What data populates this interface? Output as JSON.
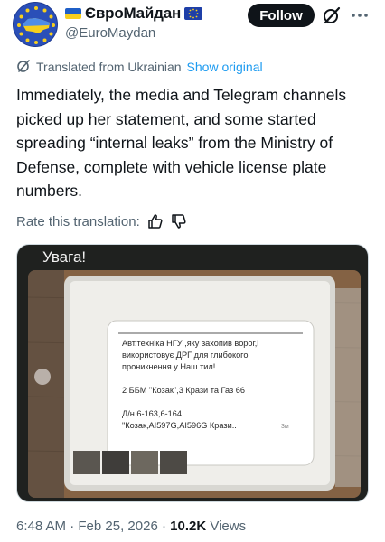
{
  "account": {
    "display_name": "ЄвроМайдан",
    "handle": "@EuroMaydan",
    "follow_label": "Follow"
  },
  "translation": {
    "label": "Translated from Ukrainian",
    "show_original": "Show original"
  },
  "tweet": {
    "text": "Immediately, the media and Telegram channels picked up her statement, and some started spreading “internal leaks” from the Ministry of Defense, complete with vehicle license plate numbers."
  },
  "rate": {
    "label": "Rate this translation:"
  },
  "media": {
    "title": "Увага!",
    "doc_lines": [
      "Авт.техніка НГУ ,яку захопив ворог,і",
      "використовує ДРГ для глибокого",
      "проникнення у Наш тил!",
      "2 ББМ \"Козак\",3 Крази та Газ 66",
      "Д/н 6-163,6-164",
      "\"Козак,АІ597G,АІ596G Крази..",
      "3м"
    ]
  },
  "meta": {
    "time": "6:48 AM",
    "date": "Feb 25, 2026",
    "separator": "·",
    "views_count": "10.2K",
    "views_label": "Views"
  },
  "colors": {
    "text": "#0f1419",
    "secondary": "#536471",
    "link": "#1d9bf0",
    "avatar_blue": "#2a4fb8",
    "ua_blue": "#1f5fc7",
    "ua_yellow": "#f6cf1e"
  },
  "icons": {
    "grok": "grok-icon",
    "more": "more-icon",
    "translate": "translate-icon",
    "thumbs_up": "thumbs-up-icon",
    "thumbs_down": "thumbs-down-icon"
  }
}
